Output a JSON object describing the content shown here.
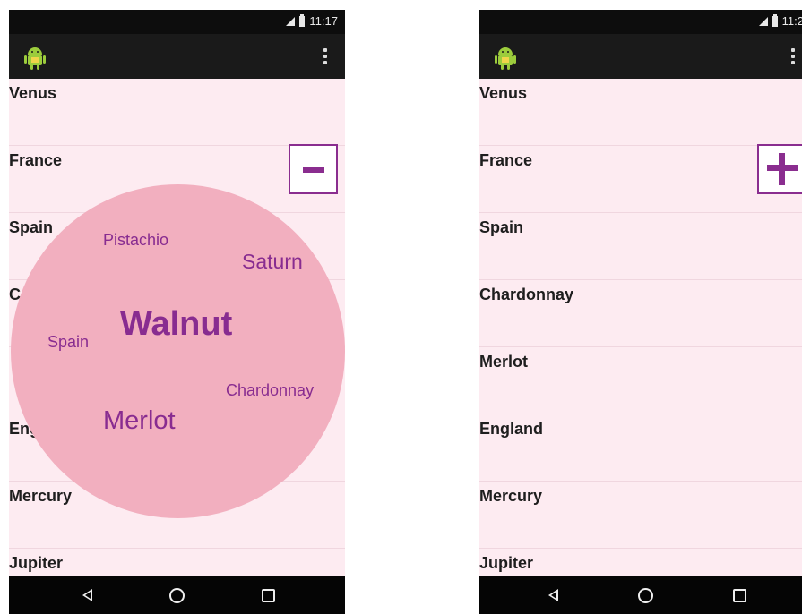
{
  "left_screen": {
    "status_time": "11:17",
    "list_items": [
      "Venus",
      "France",
      "Spain",
      "C",
      "",
      "Eng",
      "Mercury",
      "Jupiter"
    ],
    "zoom_button": "zoom-out",
    "word_cloud": {
      "words": [
        "Pistachio",
        "Saturn",
        "Walnut",
        "Spain",
        "Chardonnay",
        "Merlot"
      ],
      "highlighted": "Walnut",
      "color": "#882c90",
      "background": "#f2afbf"
    }
  },
  "right_screen": {
    "status_time": "11:2",
    "list_items": [
      "Venus",
      "France",
      "Spain",
      "Chardonnay",
      "Merlot",
      "England",
      "Mercury",
      "Jupiter"
    ],
    "zoom_button": "zoom-in"
  },
  "icons": {
    "app": "android-icon",
    "overflow": "overflow-menu-icon",
    "nav": [
      "back-icon",
      "home-icon",
      "recents-icon"
    ]
  },
  "colors": {
    "accent": "#8a2d8f",
    "list_background": "#fdebf1",
    "bars": "#1a1a1a"
  }
}
